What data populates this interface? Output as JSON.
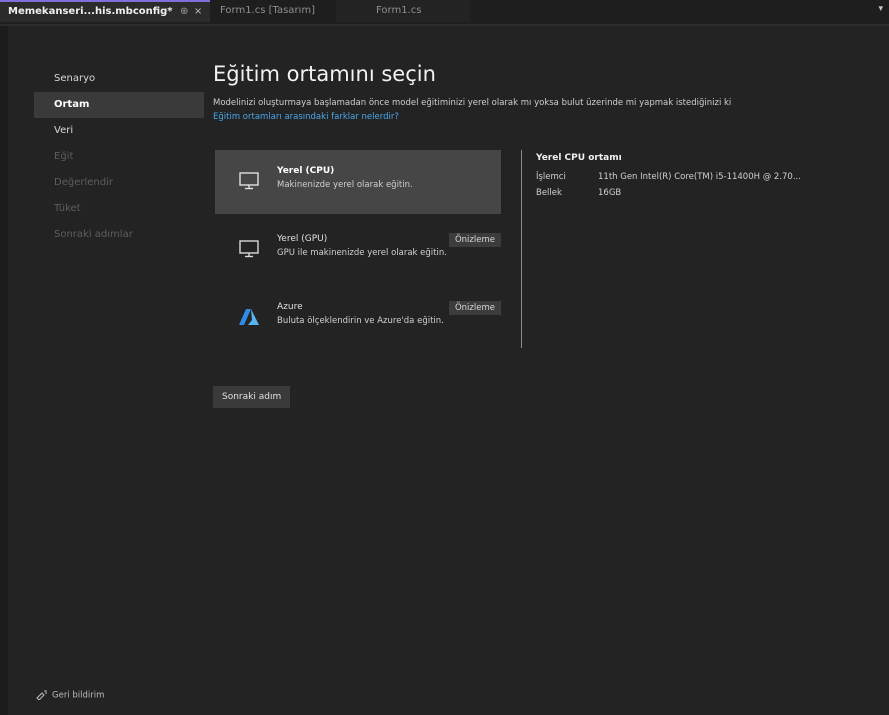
{
  "tabs": [
    {
      "label": "Memekanseri...his.mbconfig*",
      "pin": "⊕",
      "close": "×"
    },
    {
      "label": "Form1.cs [Tasarım]"
    },
    {
      "label": "Form1.cs"
    }
  ],
  "tab_dropdown": "▾",
  "nav": {
    "items": [
      {
        "label": "Senaryo"
      },
      {
        "label": "Ortam"
      },
      {
        "label": "Veri"
      },
      {
        "label": "Eğit"
      },
      {
        "label": "Değerlendir"
      },
      {
        "label": "Tüket"
      },
      {
        "label": "Sonraki adımlar"
      }
    ]
  },
  "header": {
    "title": "Eğitim ortamını seçin",
    "description": "Modelinizi oluşturmaya başlamadan önce model eğitiminizi yerel olarak mı yoksa bulut üzerinde mi yapmak istediğinizi ki",
    "link": "Eğitim ortamları arasındaki farklar nelerdir?"
  },
  "options": [
    {
      "title": "Yerel (CPU)",
      "description": "Makinenizde yerel olarak eğitin.",
      "icon": "monitor-icon"
    },
    {
      "title": "Yerel (GPU)",
      "description": "GPU ile makinenizde yerel olarak eğitin.",
      "badge": "Önizleme",
      "icon": "monitor-icon"
    },
    {
      "title": "Azure",
      "description": "Bulutа ölçeklendirin ve Azure'da eğitin.",
      "badge": "Önizleme",
      "icon": "azure-icon"
    }
  ],
  "info": {
    "title": "Yerel CPU ortamı",
    "rows": [
      {
        "key": "İşlemci",
        "value": "11th Gen Intel(R) Core(TM) i5-11400H @ 2.70..."
      },
      {
        "key": "Bellek",
        "value": "16GB"
      }
    ]
  },
  "next_button": "Sonraki adım",
  "feedback": "Geri bildirim",
  "colors": {
    "background": "#232323",
    "selected_option": "#464646",
    "link": "#4aa6e8",
    "active_tab_accent": "#7f6edb",
    "azure_blue": "#2f8ce6"
  }
}
